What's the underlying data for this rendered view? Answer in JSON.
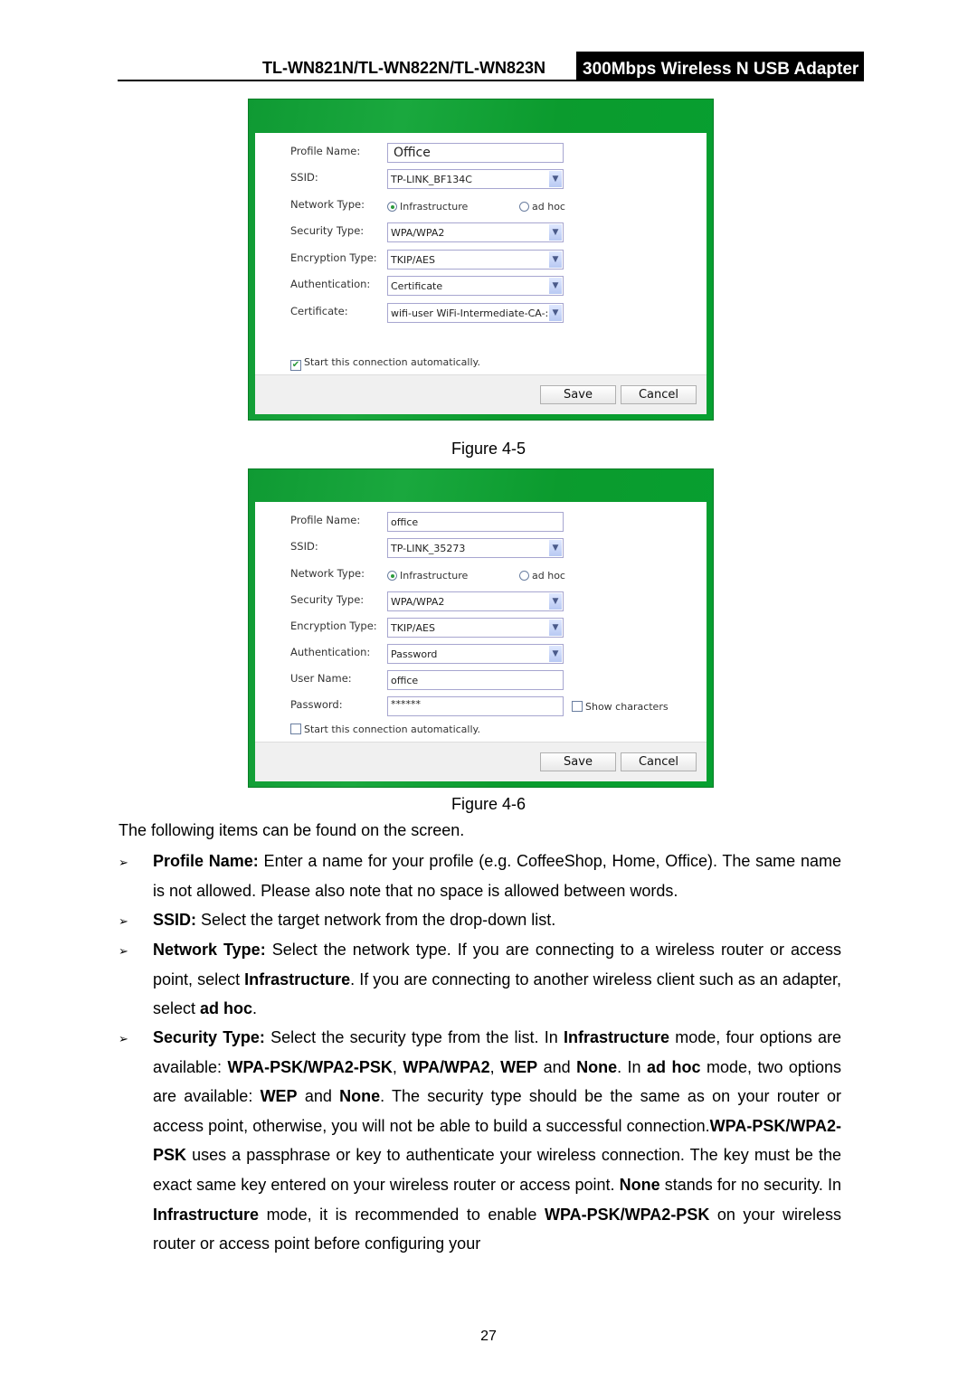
{
  "header": {
    "model": "TL-WN821N/TL-WN822N/TL-WN823N",
    "product": "300Mbps Wireless N USB Adapter"
  },
  "figure1": {
    "caption": "Figure 4-5",
    "labels": {
      "profile_name": "Profile Name:",
      "ssid": "SSID:",
      "network_type": "Network Type:",
      "security_type": "Security Type:",
      "encryption_type": "Encryption Type:",
      "authentication": "Authentication:",
      "certificate": "Certificate:"
    },
    "profile_name": "Office",
    "ssid": "TP-LINK_BF134C",
    "network_type_options": [
      "Infrastructure",
      "ad hoc"
    ],
    "network_type_selected": "Infrastructure",
    "security_type": "WPA/WPA2",
    "encryption_type": "TKIP/AES",
    "authentication": "Certificate",
    "certificate": "wifi-user  WiFi-Intermediate-CA-:",
    "auto_connect_label": "Start this connection automatically.",
    "auto_connect_checked": true,
    "save": "Save",
    "cancel": "Cancel"
  },
  "figure2": {
    "caption": "Figure 4-6",
    "labels": {
      "profile_name": "Profile Name:",
      "ssid": "SSID:",
      "network_type": "Network Type:",
      "security_type": "Security Type:",
      "encryption_type": "Encryption Type:",
      "authentication": "Authentication:",
      "user_name": "User Name:",
      "password": "Password:"
    },
    "profile_name": "office",
    "ssid": "TP-LINK_35273",
    "network_type_options": [
      "Infrastructure",
      "ad hoc"
    ],
    "network_type_selected": "Infrastructure",
    "security_type": "WPA/WPA2",
    "encryption_type": "TKIP/AES",
    "authentication": "Password",
    "user_name": "office",
    "password": "******",
    "show_characters": "Show characters",
    "auto_connect_label": "Start this connection automatically.",
    "auto_connect_checked": false,
    "save": "Save",
    "cancel": "Cancel"
  },
  "intro": "The following items can be found on the screen.",
  "items": [
    [
      {
        "b": true,
        "t": "Profile Name:"
      },
      {
        "t": " Enter a name for your profile (e.g. CoffeeShop, Home, Office). The same name is not allowed. Please also note that no space is allowed between words."
      }
    ],
    [
      {
        "b": true,
        "t": "SSID:"
      },
      {
        "t": " Select the target network from the drop-down list."
      }
    ],
    [
      {
        "b": true,
        "t": "Network Type:"
      },
      {
        "t": " Select the network type. If you are connecting to a wireless router or access point, select "
      },
      {
        "b": true,
        "t": "Infrastructure"
      },
      {
        "t": ". If you are connecting to another wireless client such as an adapter, select "
      },
      {
        "b": true,
        "t": "ad hoc"
      },
      {
        "t": "."
      }
    ],
    [
      {
        "b": true,
        "t": "Security Type:"
      },
      {
        "t": " Select the security type from the list. In "
      },
      {
        "b": true,
        "t": "Infrastructure"
      },
      {
        "t": " mode, four options are available: "
      },
      {
        "b": true,
        "t": "WPA-PSK/WPA2-PSK"
      },
      {
        "t": ", "
      },
      {
        "b": true,
        "t": "WPA/WPA2"
      },
      {
        "t": ", "
      },
      {
        "b": true,
        "t": "WEP"
      },
      {
        "t": " and "
      },
      {
        "b": true,
        "t": "None"
      },
      {
        "t": ". In "
      },
      {
        "b": true,
        "t": "ad hoc"
      },
      {
        "t": " mode, two options are available: "
      },
      {
        "b": true,
        "t": "WEP"
      },
      {
        "t": " and "
      },
      {
        "b": true,
        "t": "None"
      },
      {
        "t": ". The security type should be the same as on your router or access point, otherwise, you will not be able to build a successful connection."
      },
      {
        "b": true,
        "t": "WPA-PSK/WPA2-PSK"
      },
      {
        "t": " uses a passphrase or key to authenticate your wireless connection. The key must be the exact same key entered on your wireless router or access point. "
      },
      {
        "b": true,
        "t": "None"
      },
      {
        "t": " stands for no security. In "
      },
      {
        "b": true,
        "t": "Infrastructure"
      },
      {
        "t": " mode, it is recommended to enable "
      },
      {
        "b": true,
        "t": "WPA-PSK/WPA2-PSK"
      },
      {
        "t": " on your wireless router or access point before configuring your"
      }
    ]
  ],
  "bullet_glyph": "➢",
  "page_number": "27"
}
